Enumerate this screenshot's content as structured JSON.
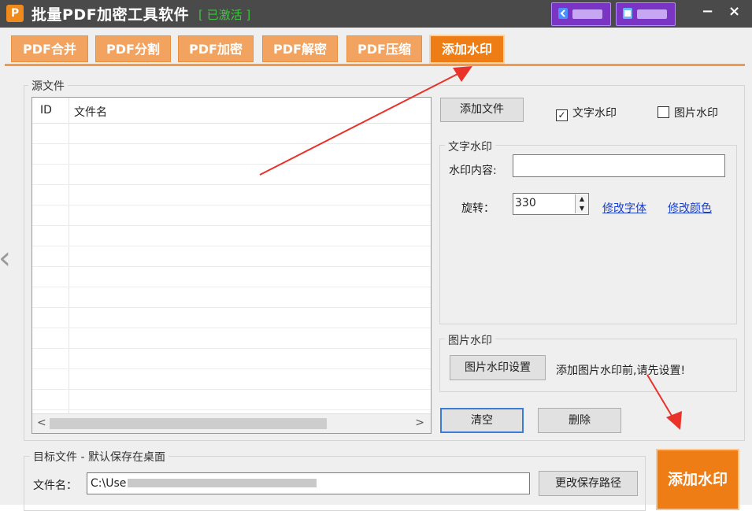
{
  "window": {
    "app_icon": "P",
    "title": "批量PDF加密工具软件",
    "activated": "[ 已激活 ]",
    "minimize": "−",
    "close": "×"
  },
  "tabs": [
    {
      "label": "PDF合并"
    },
    {
      "label": "PDF分割"
    },
    {
      "label": "PDF加密"
    },
    {
      "label": "PDF解密"
    },
    {
      "label": "PDF压缩"
    },
    {
      "label": "添加水印"
    }
  ],
  "source": {
    "legend": "源文件",
    "col_id": "ID",
    "col_name": "文件名",
    "scroll_left": "<",
    "scroll_right": ">"
  },
  "controls": {
    "add_file": "添加文件",
    "text_watermark_check": "文字水印",
    "text_watermark_checked": "✓",
    "image_watermark_check": "图片水印",
    "clear": "清空",
    "delete": "删除"
  },
  "text_watermark": {
    "legend": "文字水印",
    "content_label": "水印内容:",
    "content_value": "",
    "rotate_label": "旋转：",
    "rotate_value": "330",
    "change_font": "修改字体",
    "change_color": "修改颜色"
  },
  "image_watermark": {
    "legend": "图片水印",
    "settings_button": "图片水印设置",
    "hint": "添加图片水印前,请先设置!"
  },
  "target": {
    "legend": "目标文件 - 默认保存在桌面",
    "filename_label": "文件名：",
    "path_prefix": "C:\\Use",
    "change_path": "更改保存路径"
  },
  "run_button": "添加水印",
  "colors": {
    "accent": "#ef7d16",
    "tab": "#f2a35f",
    "titlebar": "#4a4a4a",
    "activated": "#3fc43f",
    "arrow": "#e8322a"
  }
}
